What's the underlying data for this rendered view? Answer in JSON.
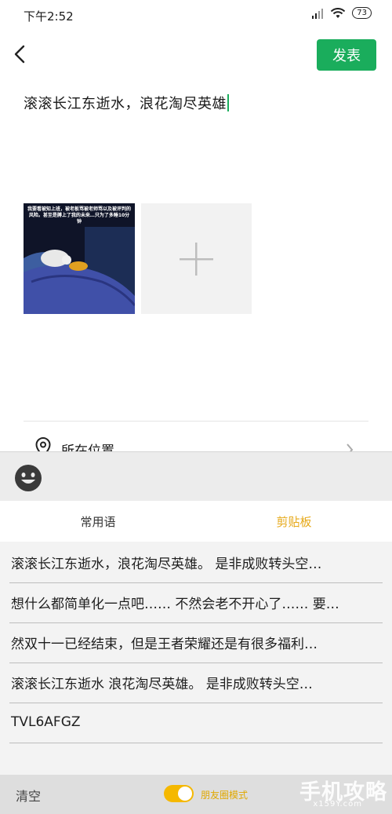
{
  "status_bar": {
    "time": "下午2:52",
    "battery": "73"
  },
  "header": {
    "publish_label": "发表"
  },
  "post": {
    "text": "滚滚长江东逝水，浪花淘尽英雄"
  },
  "photo_caption": "我要看被知上班，被老板骂被老师骂以及被评判的风险。甚至是膊上了我的未来…只为了多睡10分钟",
  "location": {
    "label": "所在位置"
  },
  "tabs": {
    "common": "常用语",
    "clipboard": "剪贴板"
  },
  "clipboard_items": [
    "滚滚长江东逝水，浪花淘尽英雄。 是非成败转头空…",
    "想什么都简单化一点吧…… 不然会老不开心了…… 要…",
    "然双十一已经结束，但是王者荣耀还是有很多福利…",
    "滚滚长江东逝水 浪花淘尽英雄。 是非成败转头空…",
    "TVL6AFGZ"
  ],
  "bottom": {
    "clear_label": "清空",
    "mode_label": "朋友圈模式",
    "watermark": "手机攻略",
    "watermark_sub": "x159Y.com"
  },
  "colors": {
    "accent_green": "#1aad5c",
    "accent_yellow": "#e6a817"
  }
}
